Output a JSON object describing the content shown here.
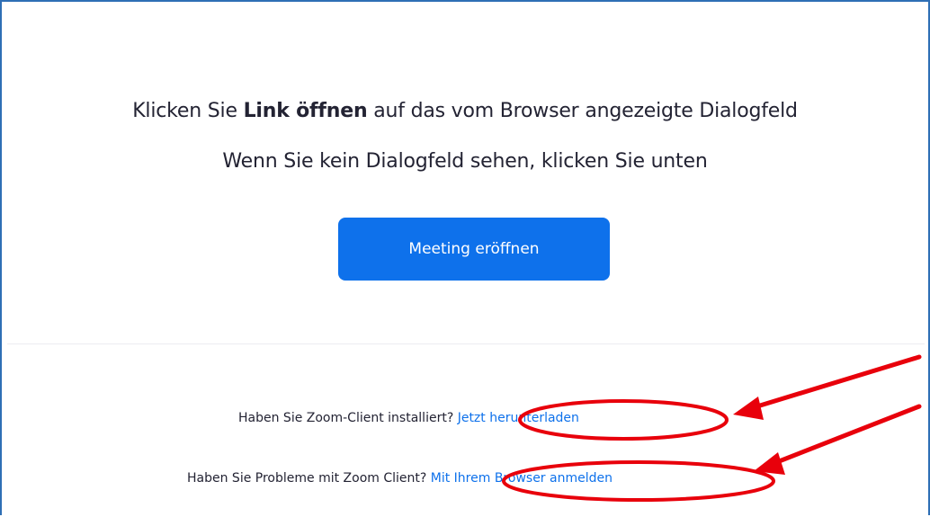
{
  "instructions": {
    "line1_pre": "Klicken Sie ",
    "line1_bold": "Link öffnen",
    "line1_post": " auf das vom Browser angezeigte Dialogfeld",
    "line2": "Wenn Sie kein Dialogfeld sehen, klicken Sie unten"
  },
  "launch_button": {
    "label": "Meeting eröffnen"
  },
  "help": {
    "install_question": "Haben Sie Zoom-Client installiert?",
    "install_link": "Jetzt herunterladen",
    "problem_question": "Haben Sie Probleme mit Zoom Client?",
    "problem_link": "Mit Ihrem Browser anmelden"
  },
  "colors": {
    "accent": "#0e71eb",
    "annotation": "#e8000b",
    "frame": "#2f6fb5"
  }
}
